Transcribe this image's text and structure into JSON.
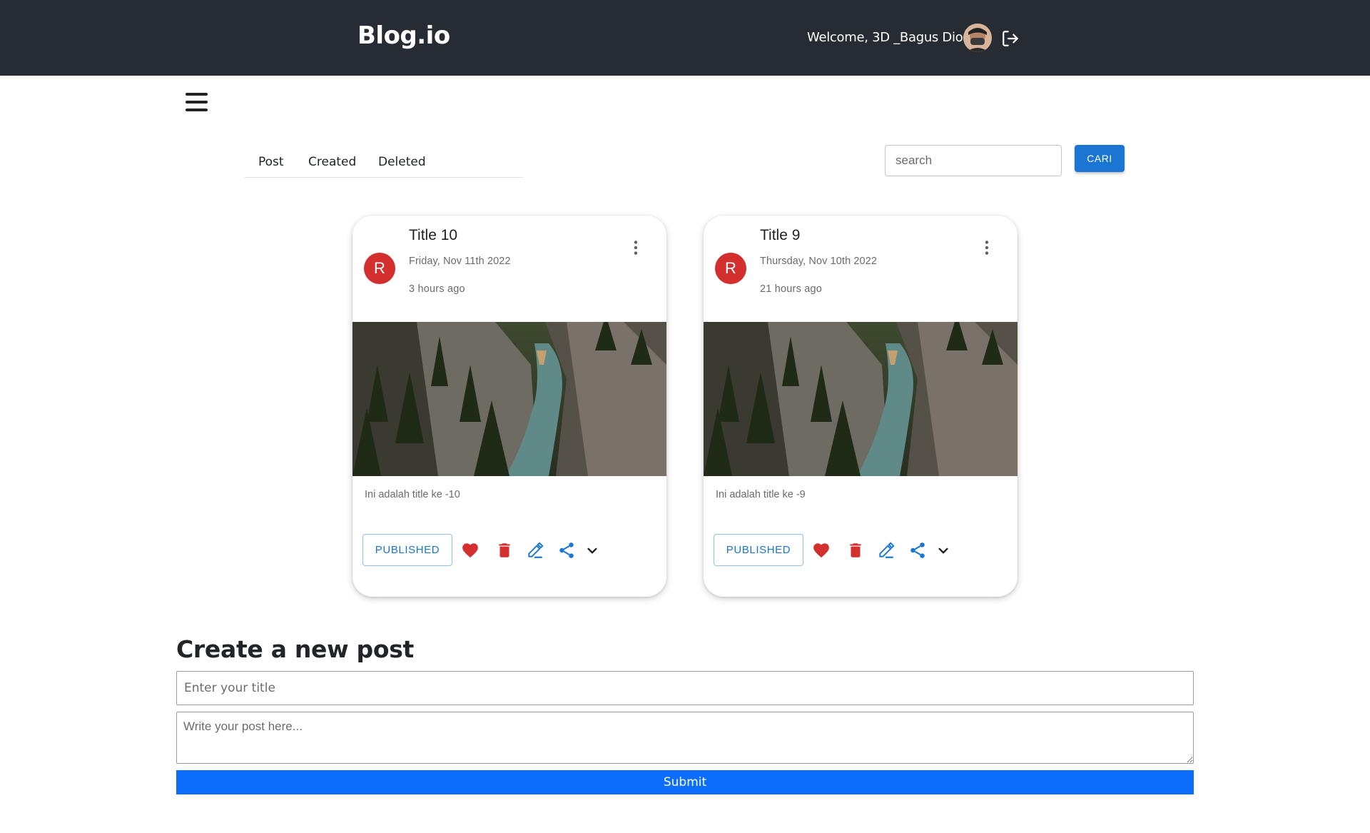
{
  "header": {
    "brand": "Blog.io",
    "welcome": "Welcome, 3D _Bagus Dio!",
    "avatar_icon": "user-avatar-photo",
    "logout_icon": "logout-icon"
  },
  "menu": {
    "icon": "hamburger-menu-icon"
  },
  "tabs": [
    {
      "label": "Post"
    },
    {
      "label": "Created"
    },
    {
      "label": "Deleted"
    }
  ],
  "search": {
    "placeholder": "search",
    "value": "",
    "button_label": "CARI"
  },
  "posts": [
    {
      "avatar_letter": "R",
      "title": "Title 10",
      "date": "Friday, Nov 11th 2022",
      "relative_time": "3 hours ago",
      "body": "Ini adalah title ke -10",
      "status": "PUBLISHED"
    },
    {
      "avatar_letter": "R",
      "title": "Title 9",
      "date": "Thursday, Nov 10th 2022",
      "relative_time": "21 hours ago",
      "body": "Ini adalah title ke -9",
      "status": "PUBLISHED"
    }
  ],
  "create_post": {
    "heading": "Create a new post",
    "title_placeholder": "Enter your title",
    "title_value": "",
    "body_placeholder": "Write your post here...",
    "body_value": "",
    "submit_label": "Submit"
  },
  "colors": {
    "navbar": "#272b33",
    "avatar_bg": "#d32f2f",
    "primary": "#1976d2",
    "submit": "#0d6efd",
    "like": "#d32f2f",
    "delete": "#d32f2f",
    "edit": "#1976d2",
    "share": "#1976d2"
  }
}
